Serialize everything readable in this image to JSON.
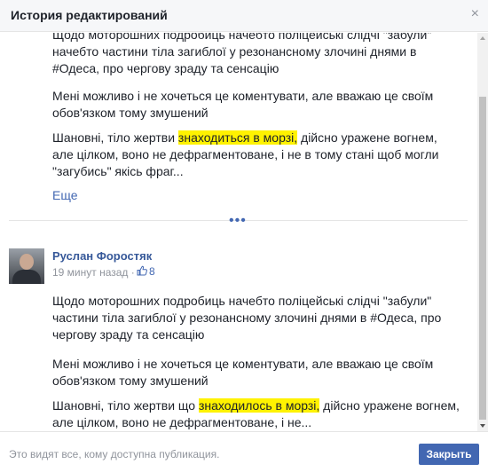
{
  "dialog": {
    "title": "История редактирований",
    "close_symbol": "×"
  },
  "prev_revision": {
    "para1": "Щодо моторошних подробиць начебто поліцейські слідчі \"забули\" начебто частини тіла загиблої у резонансному злочині днями в #Одеса, про чергову зраду та сенсацію",
    "para2": "Мені можливо і не хочеться це коментувати, але вважаю це своїм обов'язком тому змушений",
    "para3_before": "Шановні, тіло жертви ",
    "para3_highlight": "знаходиться в морзі,",
    "para3_after": " дійсно уражене вогнем, але цілком, воно не дефрагментоване, і не в тому стані щоб могли \"загубись\" якісь фраг...",
    "more_label": "Еще"
  },
  "separator": {
    "dots": "•••"
  },
  "revision": {
    "author": "Руслан Форостяк",
    "timestamp": "19 минут назад",
    "separator": "·",
    "like_count": "8",
    "para1": "Щодо моторошних подробиць начебто поліцейські слідчі \"забули\" частини тіла загиблої у резонансному злочині днями в #Одеса, про чергову зраду та сенсацію",
    "para2": "Мені можливо і не хочеться це коментувати, але вважаю це своїм обов'язком тому змушений",
    "para3_before": "Шановні, тіло жертви що ",
    "para3_highlight": "знаходилось в морзі,",
    "para3_after": " дійсно уражене вогнем, але цілком, воно не дефрагментоване, і не..."
  },
  "footer": {
    "info": "Это видят все, кому доступна публикация.",
    "close_label": "Закрыть"
  },
  "colors": {
    "accent": "#4267b2",
    "highlight": "#fff200",
    "link": "#365899"
  }
}
